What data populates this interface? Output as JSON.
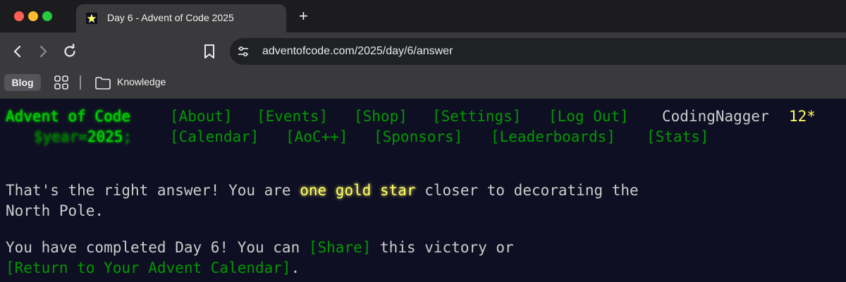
{
  "browser": {
    "tab_title": "Day 6 - Advent of Code 2025",
    "url": "adventofcode.com/2025/day/6/answer",
    "bookmarks": {
      "blog": "Blog",
      "folder": "Knowledge"
    },
    "new_tab": "+"
  },
  "header": {
    "title": "Advent of Code",
    "nav_row1": [
      "[About]",
      "[Events]",
      "[Shop]",
      "[Settings]",
      "[Log Out]"
    ],
    "user": "CodingNagger",
    "stars": "12*",
    "year_prefix": "$year=",
    "year": "2025",
    "year_suffix": ";",
    "nav_row2": [
      "[Calendar]",
      "[AoC++]",
      "[Sponsors]",
      "[Leaderboards]",
      "[Stats]"
    ]
  },
  "main": {
    "p1_a": "That's the right answer! You are ",
    "p1_star": "one gold star",
    "p1_b": " closer to decorating the",
    "p1_line2": "North Pole.",
    "p2_a": "You have completed Day 6! You can ",
    "p2_share": "[Share]",
    "p2_b": " this victory or",
    "p2_return": "[Return to Your Advent Calendar]",
    "p2_end": "."
  },
  "colors": {
    "background": "#0f0f23",
    "text": "#cccccc",
    "link": "#009900",
    "title_glow": "#00cc00",
    "gold": "#ffff66"
  }
}
